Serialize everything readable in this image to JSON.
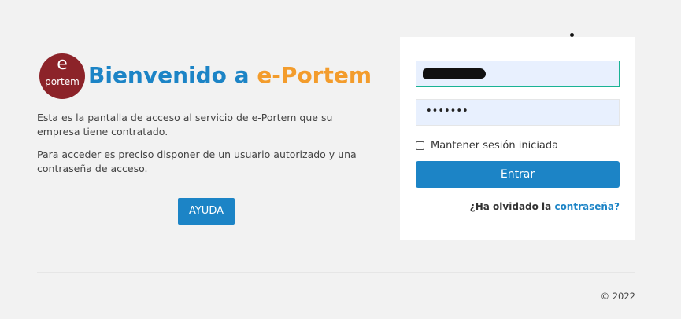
{
  "logo": {
    "letter": "e",
    "word": "portem"
  },
  "header": {
    "title_prefix": "Bienvenido a ",
    "title_brand": "e-Portem"
  },
  "intro": {
    "paragraph_1": "Esta es la pantalla de acceso al servicio de e-Portem que su empresa tiene contratado.",
    "paragraph_2": "Para acceder es preciso disponer de un usuario autorizado y una contraseña de acceso."
  },
  "help_button": {
    "label": "AYUDA"
  },
  "login": {
    "password_mask": "•••••••",
    "remember_label": "Mantener sesión iniciada",
    "submit_label": "Entrar",
    "forgot_prefix": "¿Ha olvidado la ",
    "forgot_link": "contraseña?"
  },
  "footer": {
    "copyright": "© 2022"
  },
  "colors": {
    "accent": "#1c84c6",
    "brand_orange": "#f39c2c",
    "logo_red": "#8c2329",
    "focus_border": "#1ab394"
  }
}
